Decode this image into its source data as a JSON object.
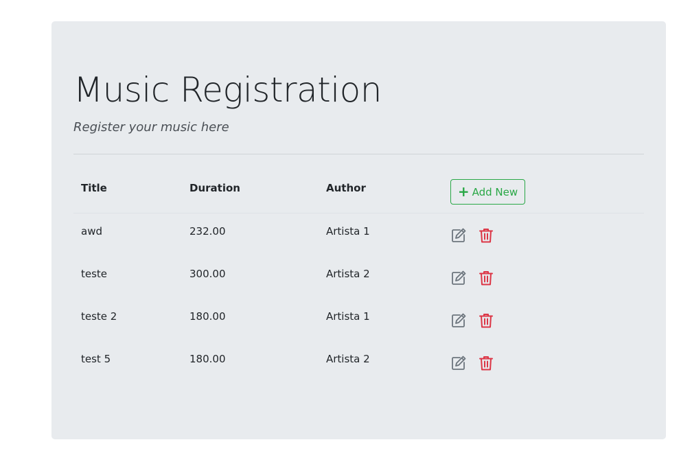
{
  "header": {
    "title": "Music Registration",
    "subtitle": "Register your music here"
  },
  "table": {
    "columns": [
      "Title",
      "Duration",
      "Author"
    ],
    "add_button_label": "Add New",
    "rows": [
      {
        "title": "awd",
        "duration": "232.00",
        "author": "Artista 1"
      },
      {
        "title": "teste",
        "duration": "300.00",
        "author": "Artista 2"
      },
      {
        "title": "teste 2",
        "duration": "180.00",
        "author": "Artista 1"
      },
      {
        "title": "test 5",
        "duration": "180.00",
        "author": "Artista 2"
      }
    ]
  },
  "icons": {
    "add": "plus-icon",
    "edit": "edit-icon",
    "delete": "trash-icon"
  },
  "colors": {
    "background": "#e8ebee",
    "success": "#28a745",
    "danger": "#dc3545",
    "secondary": "#6c757d"
  }
}
